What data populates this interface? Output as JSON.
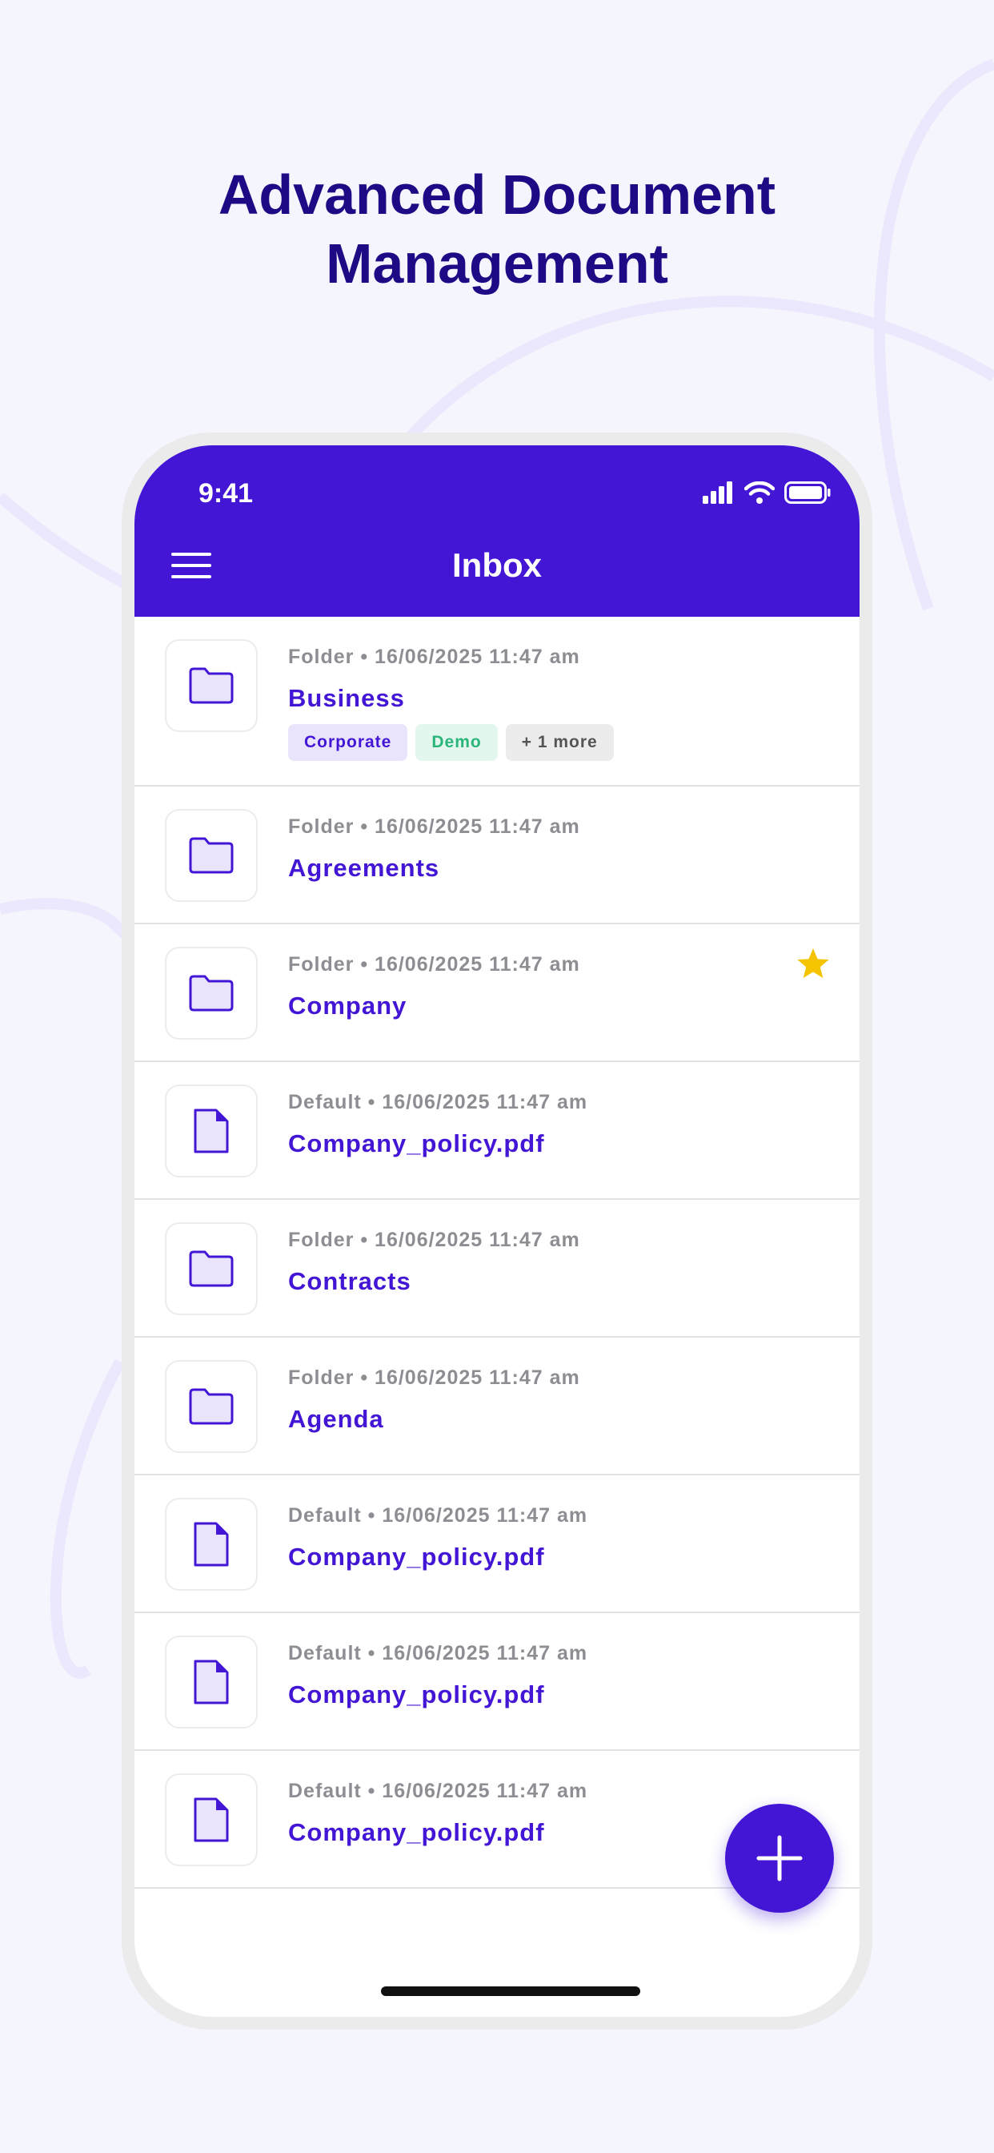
{
  "headline": {
    "line1": "Advanced Document",
    "line2": "Management"
  },
  "status_bar": {
    "time": "9:41"
  },
  "app_bar": {
    "title": "Inbox"
  },
  "items": [
    {
      "meta": "Folder • 16/06/2025 11:47 am",
      "name": "Business",
      "icon": "folder-icon",
      "tags": [
        {
          "label": "Corporate"
        },
        {
          "label": "Demo"
        },
        {
          "label": "+ 1 more"
        }
      ]
    },
    {
      "meta": "Folder • 16/06/2025 11:47 am",
      "name": "Agreements",
      "icon": "folder-icon"
    },
    {
      "meta": "Folder • 16/06/2025 11:47 am",
      "name": "Company",
      "icon": "folder-icon",
      "starred": true
    },
    {
      "meta": "Default • 16/06/2025 11:47 am",
      "name": "Company_policy.pdf",
      "icon": "document-icon"
    },
    {
      "meta": "Folder • 16/06/2025 11:47 am",
      "name": "Contracts",
      "icon": "folder-icon"
    },
    {
      "meta": "Folder • 16/06/2025 11:47 am",
      "name": "Agenda",
      "icon": "folder-icon"
    },
    {
      "meta": "Default • 16/06/2025 11:47 am",
      "name": "Company_policy.pdf",
      "icon": "document-icon"
    },
    {
      "meta": "Default • 16/06/2025 11:47 am",
      "name": "Company_policy.pdf",
      "icon": "document-icon"
    },
    {
      "meta": "Default • 16/06/2025 11:47 am",
      "name": "Company_policy.pdf",
      "icon": "document-icon"
    }
  ],
  "fab": {
    "icon": "plus-icon"
  },
  "colors": {
    "accent": "#4316d6",
    "headline": "#1e0a85",
    "background": "#f4f5fd",
    "star": "#f5c400",
    "tag_purple_bg": "#e9e4fb",
    "tag_green_bg": "#e3f7ef",
    "tag_gray_bg": "#ececec"
  }
}
